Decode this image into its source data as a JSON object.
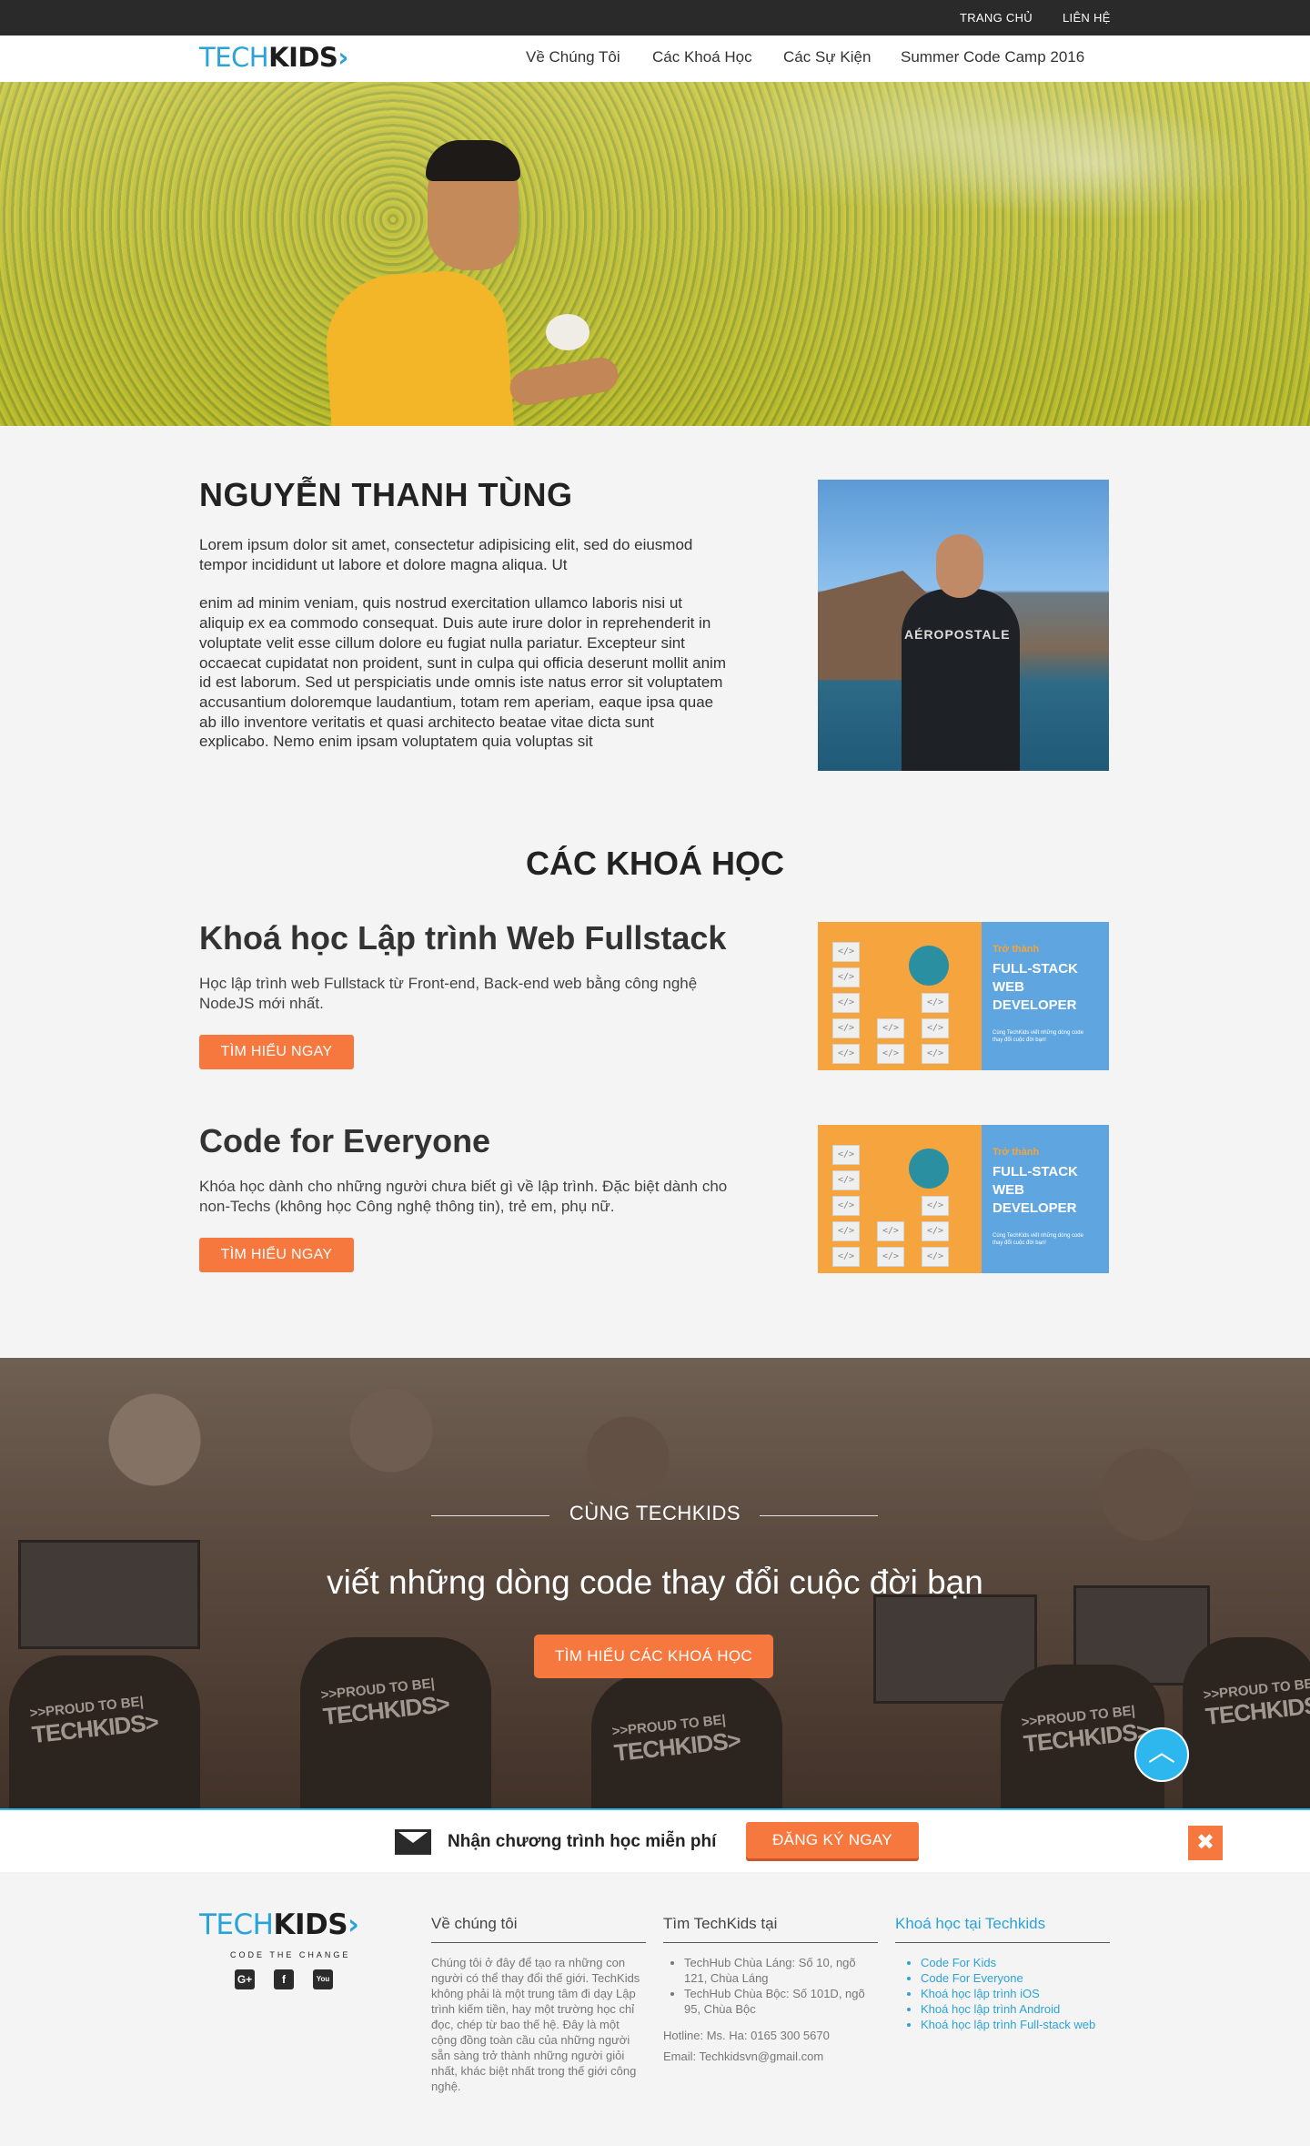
{
  "topbar": {
    "home": "TRANG CHỦ",
    "contact": "LIÊN HỆ"
  },
  "brand": {
    "tech": "TECH",
    "kids": "KIDS",
    "chevron": "›",
    "tagline": "CODE THE CHANGE"
  },
  "nav": {
    "items": [
      "Về Chúng Tôi",
      "Các Khoá Học",
      "Các Sự Kiện",
      "Summer Code Camp 2016"
    ]
  },
  "profile": {
    "name": "NGUYỄN THANH TÙNG",
    "bio_1": "Lorem ipsum dolor sit amet, consectetur adipisicing elit, sed do eiusmod tempor incididunt ut labore et dolore magna aliqua. Ut",
    "bio_2": "enim ad minim veniam, quis nostrud exercitation ullamco laboris nisi ut aliquip ex ea commodo consequat. Duis aute irure dolor in reprehenderit in voluptate velit esse cillum dolore eu fugiat nulla pariatur. Excepteur sint occaecat cupidatat non proident, sunt in culpa qui officia deserunt mollit anim id est laborum. Sed ut perspiciatis unde omnis iste natus error sit voluptatem accusantium doloremque laudantium, totam rem aperiam, eaque ipsa quae ab illo inventore veritatis et quasi architecto beatae vitae dicta sunt explicabo. Nemo enim ipsam voluptatem quia voluptas sit",
    "shirt_text": "AÉROPOSTALE"
  },
  "courses": {
    "title": "CÁC KHOÁ HỌC",
    "items": [
      {
        "title": "Khoá học Lập trình Web Fullstack",
        "desc": "Học lập trình web Fullstack từ Front-end, Back-end web bằng công nghệ NodeJS mới nhất.",
        "button": "TÌM HIỂU NGAY"
      },
      {
        "title": "Code for Everyone",
        "desc": "Khóa học dành cho những người chưa biết gì về lập trình. Đặc biệt dành cho non-Techs (không học Công nghệ thông tin), trẻ em, phụ nữ.",
        "button": "TÌM HIỂU NGAY"
      }
    ],
    "thumb": {
      "small": "Trở thành",
      "big_1": "FULL-STACK",
      "big_2": "WEB",
      "big_3": "DEVELOPER",
      "tiny": "Cùng TechKids viết những dòng code thay đổi cuộc đời bạn!",
      "code_glyph": "</>"
    }
  },
  "banner": {
    "subtitle": "CÙNG TECHKIDS",
    "title": "viết những dòng code thay đổi cuộc đời bạn",
    "button": "TÌM HIỂU CÁC KHOÁ HỌC",
    "shirt_small": ">>PROUD TO BE|",
    "shirt_big": "TECHKIDS>",
    "scroll_top": "︿"
  },
  "signup": {
    "text": "Nhận chương trình học miễn phí",
    "button": "ĐĂNG KÝ NGAY",
    "close": "✖"
  },
  "footer": {
    "social": [
      "G+",
      "f",
      "You"
    ],
    "about": {
      "title": "Về chúng tôi",
      "text": "Chúng tôi ở đây để tạo ra những con người có thể thay đổi thế giới. TechKids không phải là một trung tâm đi dạy Lập trình kiếm tiền, hay một trường học chỉ đọc, chép từ bao thế hệ. Đây là một cộng đồng toàn cầu của những người sẵn sàng trở thành những người giỏi nhất, khác biệt nhất trong thế giới công nghệ."
    },
    "find": {
      "title": "Tìm TechKids tại",
      "addresses": [
        "TechHub Chùa Láng: Số 10, ngõ 121, Chùa Láng",
        "TechHub Chùa Bộc: Số 101D, ngõ 95, Chùa Bộc"
      ],
      "hotline": "Hotline: Ms. Ha: 0165 300 5670",
      "email": "Email: Techkidsvn@gmail.com"
    },
    "courses": {
      "title": "Khoá học tại Techkids",
      "items": [
        "Code For Kids",
        "Code For Everyone",
        "Khoá học lập trình iOS",
        "Khoá học lập trình Android",
        "Khoá học lập trình Full-stack web"
      ]
    }
  }
}
